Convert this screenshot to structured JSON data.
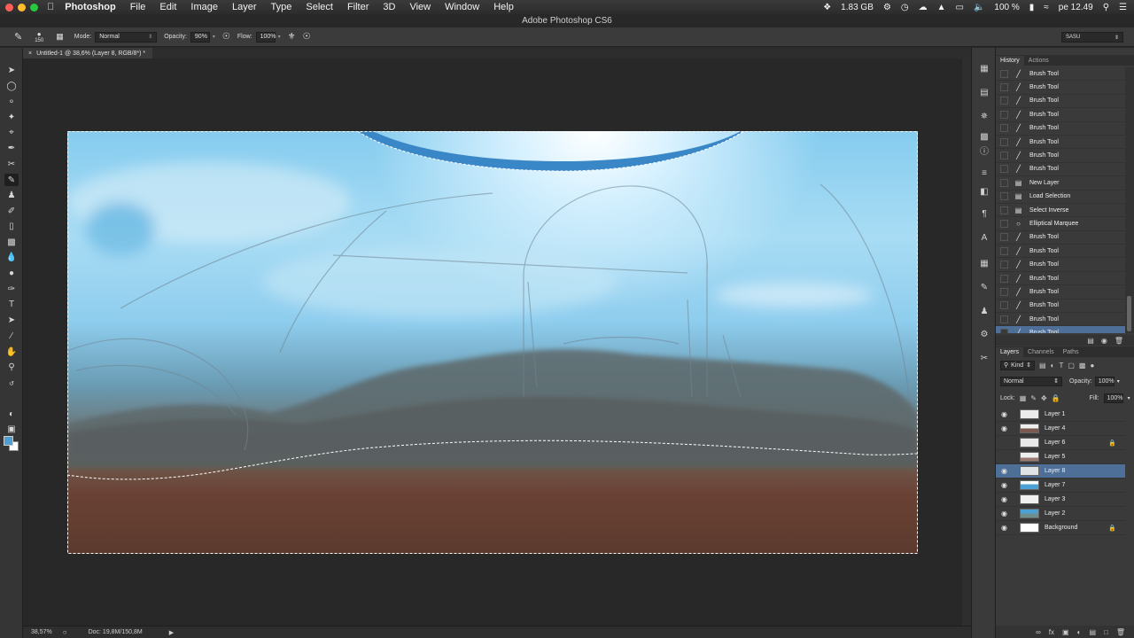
{
  "menubar": {
    "app_name": "Photoshop",
    "menus": [
      "File",
      "Edit",
      "Image",
      "Layer",
      "Type",
      "Select",
      "Filter",
      "3D",
      "View",
      "Window",
      "Help"
    ],
    "memory": "1.83 GB",
    "battery": "100 %",
    "clock": "pe 12.49"
  },
  "window": {
    "title": "Adobe Photoshop CS6"
  },
  "options": {
    "brush_size": "150",
    "mode_label": "Mode:",
    "mode_value": "Normal",
    "opacity_label": "Opacity:",
    "opacity_value": "90%",
    "flow_label": "Flow:",
    "flow_value": "100%",
    "workspace": "SASU"
  },
  "document": {
    "tab_title": "Untitled-1 @ 38,6% (Layer 8, RGB/8*) *"
  },
  "status": {
    "zoom": "38,57%",
    "doc_size": "Doc: 19,8M/150,8M"
  },
  "colors": {
    "foreground": "#4e9fd1",
    "background": "#ffffff",
    "selection_highlight": "#4e6f97"
  },
  "history": {
    "tabs": [
      "History",
      "Actions"
    ],
    "items": [
      {
        "label": "Brush Tool",
        "icon": "brush-icon"
      },
      {
        "label": "Brush Tool",
        "icon": "brush-icon"
      },
      {
        "label": "Brush Tool",
        "icon": "brush-icon"
      },
      {
        "label": "Brush Tool",
        "icon": "brush-icon"
      },
      {
        "label": "Brush Tool",
        "icon": "brush-icon"
      },
      {
        "label": "Brush Tool",
        "icon": "brush-icon"
      },
      {
        "label": "Brush Tool",
        "icon": "brush-icon"
      },
      {
        "label": "Brush Tool",
        "icon": "brush-icon"
      },
      {
        "label": "New Layer",
        "icon": "layer-icon"
      },
      {
        "label": "Load Selection",
        "icon": "layer-icon"
      },
      {
        "label": "Select Inverse",
        "icon": "layer-icon"
      },
      {
        "label": "Elliptical Marquee",
        "icon": "ellipse-icon"
      },
      {
        "label": "Brush Tool",
        "icon": "brush-icon"
      },
      {
        "label": "Brush Tool",
        "icon": "brush-icon"
      },
      {
        "label": "Brush Tool",
        "icon": "brush-icon"
      },
      {
        "label": "Brush Tool",
        "icon": "brush-icon"
      },
      {
        "label": "Brush Tool",
        "icon": "brush-icon"
      },
      {
        "label": "Brush Tool",
        "icon": "brush-icon"
      },
      {
        "label": "Brush Tool",
        "icon": "brush-icon"
      },
      {
        "label": "Brush Tool",
        "icon": "brush-icon"
      }
    ],
    "selected_index": 19
  },
  "layers": {
    "tabs": [
      "Layers",
      "Channels",
      "Paths"
    ],
    "filter_label": "Kind",
    "blend_mode": "Normal",
    "opacity_label": "Opacity:",
    "opacity_value": "100%",
    "lock_label": "Lock:",
    "fill_label": "Fill:",
    "fill_value": "100%",
    "items": [
      {
        "name": "Layer 1",
        "visible": true,
        "locked": false
      },
      {
        "name": "Layer 4",
        "visible": true,
        "locked": false
      },
      {
        "name": "Layer 6",
        "visible": false,
        "locked": true
      },
      {
        "name": "Layer 5",
        "visible": false,
        "locked": false
      },
      {
        "name": "Layer 8",
        "visible": true,
        "locked": false
      },
      {
        "name": "Layer 7",
        "visible": true,
        "locked": false
      },
      {
        "name": "Layer 3",
        "visible": true,
        "locked": false
      },
      {
        "name": "Layer 2",
        "visible": true,
        "locked": false
      },
      {
        "name": "Background",
        "visible": true,
        "locked": true
      }
    ],
    "selected_index": 4
  }
}
